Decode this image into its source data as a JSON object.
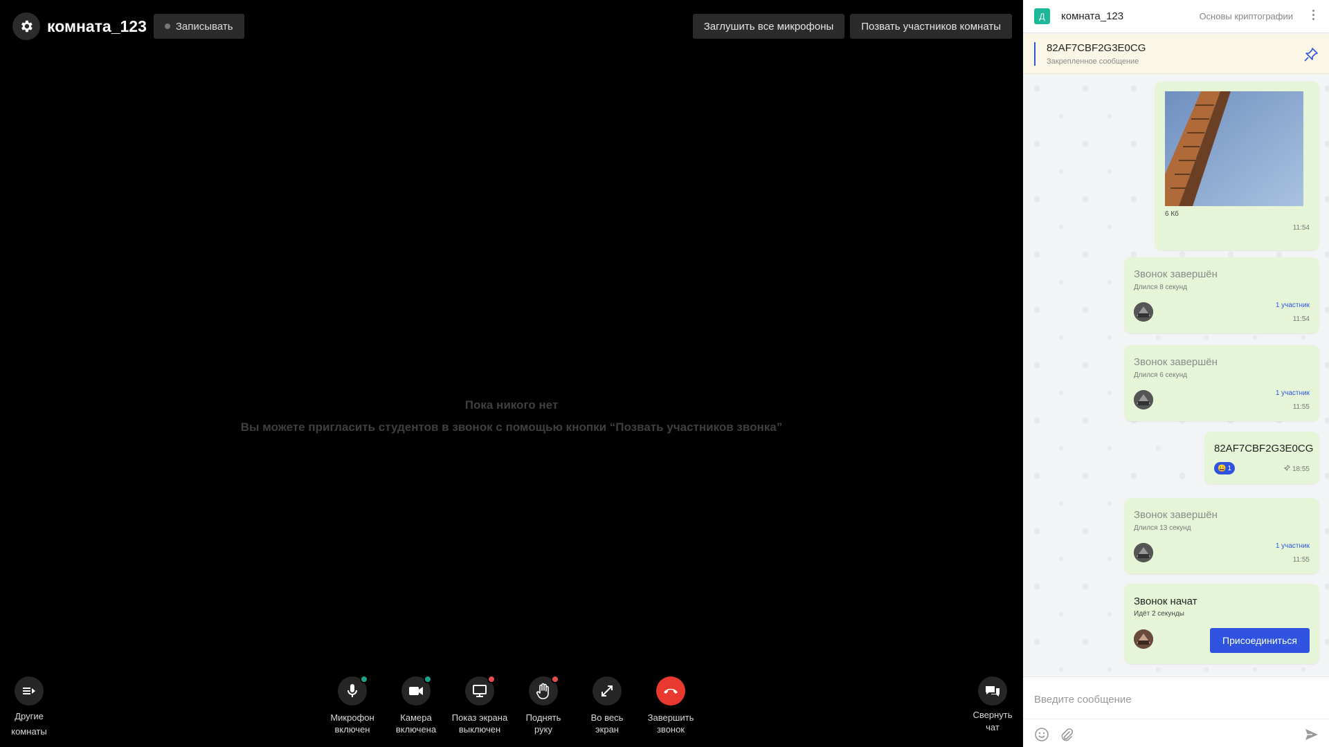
{
  "call": {
    "room_title": "комната_123",
    "record_label": "Записывать",
    "mute_all_label": "Заглушить все микрофоны",
    "invite_label": "Позвать участников комнаты",
    "empty_title": "Пока никого нет",
    "empty_hint": "Вы можете пригласить студентов в звонок с помощью кнопки “Позвать участников звонка”",
    "controls": {
      "other_rooms": [
        "Другие",
        "комнаты"
      ],
      "mic": [
        "Микрофон",
        "включен"
      ],
      "camera": [
        "Камера",
        "включена"
      ],
      "screen": [
        "Показ экрана",
        "выключен"
      ],
      "hand": [
        "Поднять",
        "руку"
      ],
      "fullscreen": [
        "Во весь",
        "экран"
      ],
      "end": [
        "Завершить",
        "звонок"
      ],
      "collapse": [
        "Свернуть",
        "чат"
      ]
    },
    "colors": {
      "indicator_on": "#1aa38a",
      "indicator_off": "#e54c4c",
      "end_call": "#e8382f"
    }
  },
  "chat": {
    "avatar_letter": "Д",
    "name": "комната_123",
    "course": "Основы криптографии",
    "pinned": {
      "text": "82AF7CBF2G3E0CG",
      "label": "Закрепленное сообщение"
    },
    "image_message": {
      "size": "6 Кб",
      "time": "11:54"
    },
    "calls": [
      {
        "title": "Звонок завершён",
        "duration": "Длился 8 секунд",
        "participants": "1 участник",
        "time": "11:54"
      },
      {
        "title": "Звонок завершён",
        "duration": "Длился 6 секунд",
        "participants": "1 участник",
        "time": "11:55"
      },
      {
        "title": "Звонок завершён",
        "duration": "Длился 13 секунд",
        "participants": "1 участник",
        "time": "11:55"
      }
    ],
    "code_message": {
      "text": "82AF7CBF2G3E0CG",
      "reaction_emoji": "😀",
      "reaction_count": "1",
      "time": "18:55"
    },
    "call_started": {
      "title": "Звонок начат",
      "status": "Идёт 2 секунды",
      "join_label": "Присоединиться"
    },
    "input_placeholder": "Введите сообщение",
    "colors": {
      "accent": "#2f52e0",
      "bubble": "#e6f5d7",
      "avatar_bg": "#1bb899"
    }
  }
}
